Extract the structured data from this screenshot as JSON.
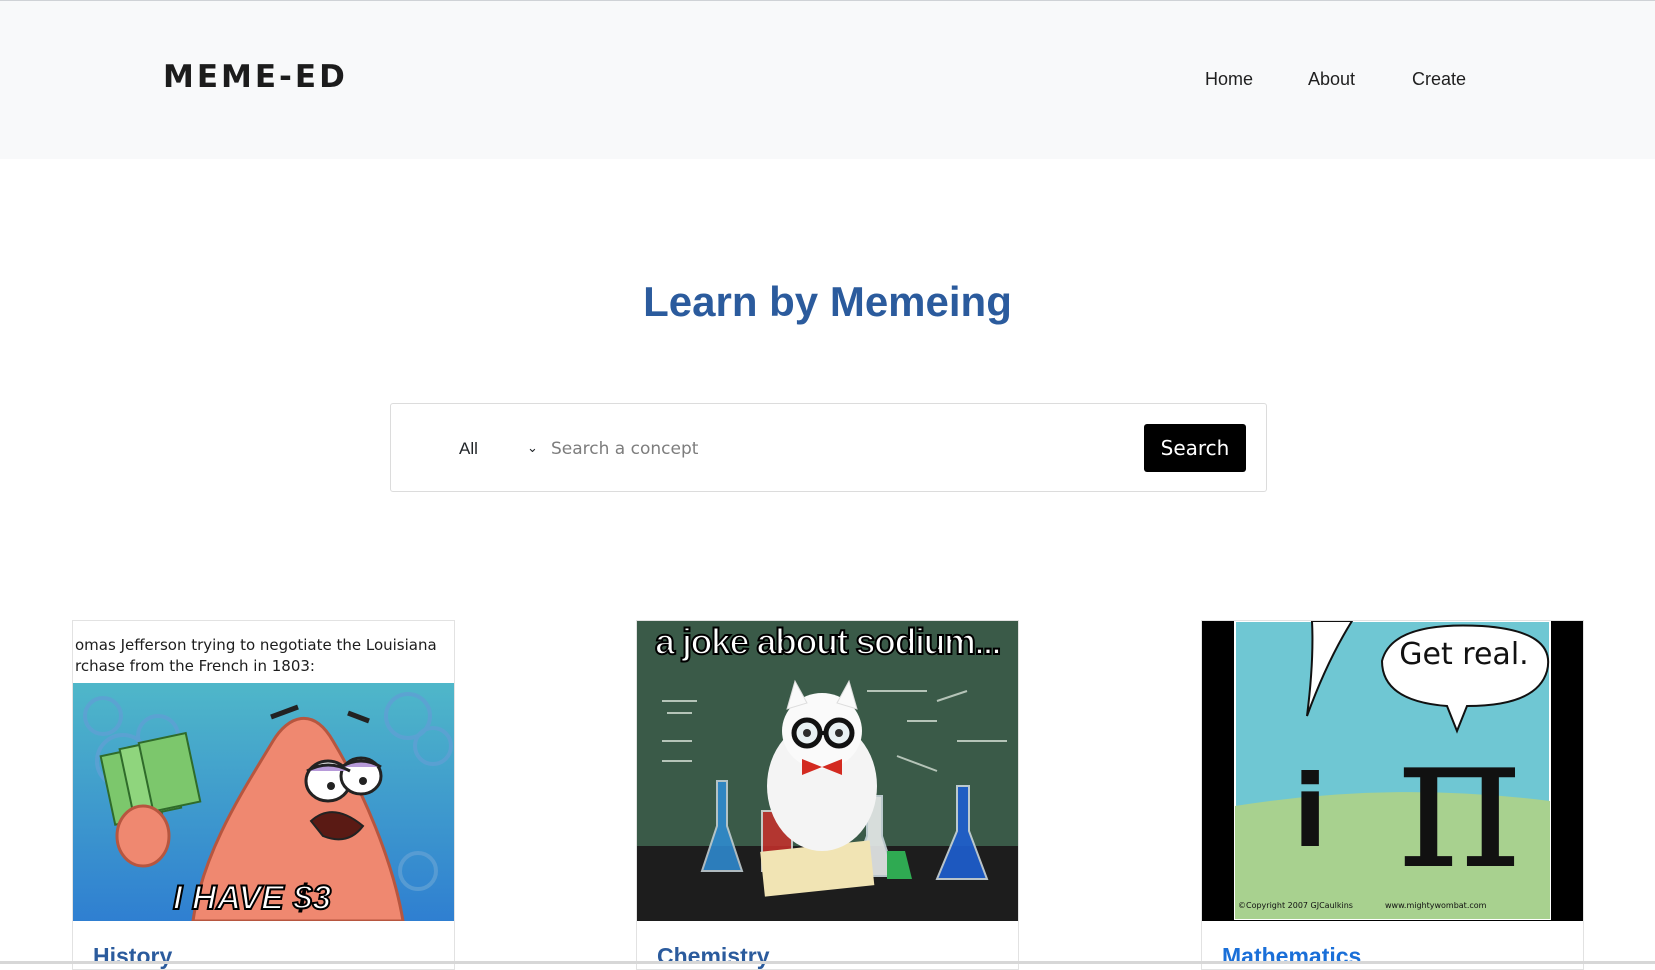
{
  "brand": "MEME-ED",
  "nav": [
    "Home",
    "About",
    "Create"
  ],
  "hero": {
    "title": "Learn by Memeing"
  },
  "search": {
    "category_selected": "All",
    "placeholder": "Search a concept",
    "button_label": "Search"
  },
  "cards": [
    {
      "title": "History",
      "title_color": "#2b5b9d",
      "caption_line1": "omas Jefferson trying to negotiate the Louisiana",
      "caption_line2": "rchase from the French in 1803:",
      "overlay": "I HAVE $3"
    },
    {
      "title": "Chemistry",
      "title_color": "#2b5b9d",
      "overlay": "a joke about sodium..."
    },
    {
      "title": "Mathematics",
      "title_color": "#1a6fd8",
      "bubble": "Get real.",
      "glyph_left": "i",
      "glyph_right": "π",
      "credit_left": "©Copyright 2007 GJCaulkins",
      "credit_right": "www.mightywombat.com"
    }
  ],
  "colors": {
    "heading": "#2b5b9d",
    "link": "#1a6fd8",
    "nav_bg": "#f8f9fa",
    "button": "#000000"
  }
}
